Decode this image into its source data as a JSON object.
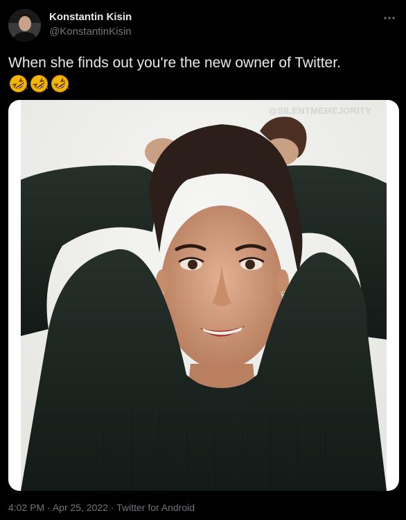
{
  "tweet": {
    "display_name": "Konstantin Kisin",
    "handle": "@KonstantinKisin",
    "text": "When she finds out you're the new owner of Twitter.",
    "emojis": [
      "rolling-on-floor-laughing",
      "rolling-on-floor-laughing",
      "rolling-on-floor-laughing"
    ],
    "more_icon": "ellipsis-icon"
  },
  "media": {
    "watermark": "@SILENTMEMEJORITY"
  },
  "meta": {
    "time": "4:02 PM",
    "separator": "·",
    "date": "Apr 25, 2022",
    "source": "Twitter for Android"
  },
  "colors": {
    "background": "#000000",
    "primary_text": "#e7e9ea",
    "secondary_text": "#71767b",
    "sweater": "#1d2520",
    "wall": "#efefed"
  }
}
